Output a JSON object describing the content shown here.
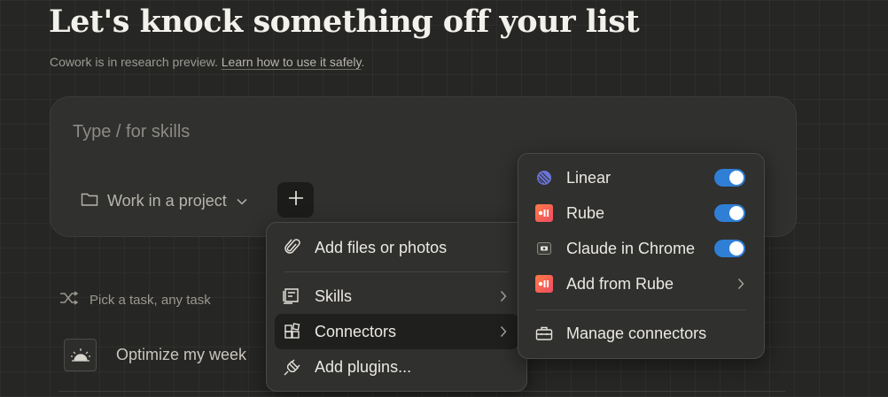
{
  "header": {
    "title": "Let's knock something off your list",
    "subtitle_prefix": "Cowork is in research preview. ",
    "subtitle_link": "Learn how to use it safely",
    "subtitle_suffix": "."
  },
  "composer": {
    "placeholder": "Type / for skills",
    "project_label": "Work in a project"
  },
  "tasks": {
    "header_label": "Pick a task, any task",
    "items": [
      {
        "label": "Optimize my week",
        "icon": "sunrise-icon"
      }
    ]
  },
  "add_menu": {
    "items": [
      {
        "label": "Add files or photos",
        "icon": "paperclip-icon",
        "has_submenu": false
      },
      {
        "label": "Skills",
        "icon": "skills-icon",
        "has_submenu": true
      },
      {
        "label": "Connectors",
        "icon": "connectors-icon",
        "has_submenu": true,
        "active": true
      },
      {
        "label": "Add plugins...",
        "icon": "plug-icon",
        "has_submenu": false
      }
    ]
  },
  "connectors_menu": {
    "items": [
      {
        "label": "Linear",
        "icon": "linear-icon",
        "toggle": true,
        "enabled": true
      },
      {
        "label": "Rube",
        "icon": "rube-icon",
        "toggle": true,
        "enabled": true
      },
      {
        "label": "Claude in Chrome",
        "icon": "chrome-extension-icon",
        "toggle": true,
        "enabled": true
      },
      {
        "label": "Add from Rube",
        "icon": "rube-icon",
        "has_submenu": true
      }
    ],
    "manage_label": "Manage connectors"
  },
  "colors": {
    "background": "#262624",
    "card": "#30302e",
    "toggle_on": "#2f7fd6",
    "linear_brand": "#6a74d9",
    "rube_brand": "#ee4d63"
  }
}
